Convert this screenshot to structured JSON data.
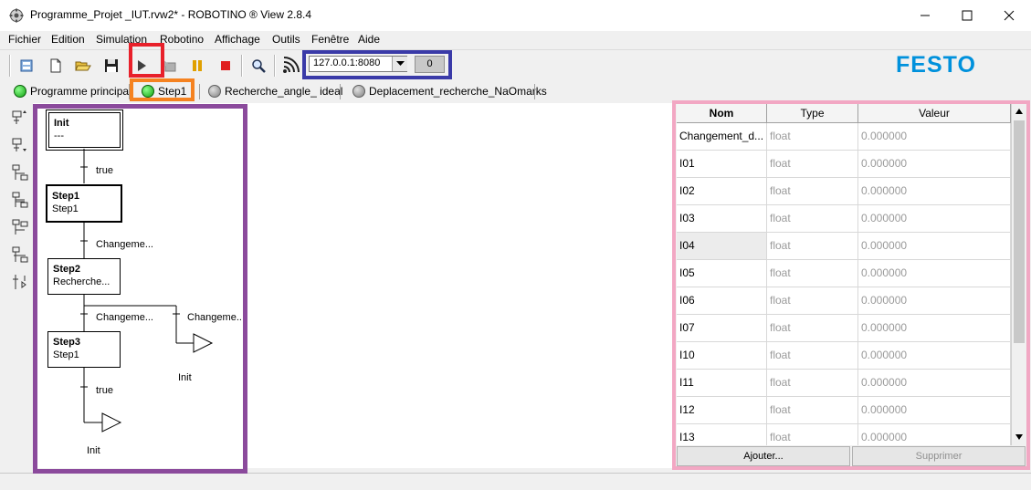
{
  "window": {
    "title": "Programme_Projet _IUT.rvw2* - ROBOTINO ® View 2.8.4"
  },
  "menu": [
    "Fichier",
    "Edition",
    "Simulation",
    "Robotino",
    "Affichage",
    "Outils",
    "Fenêtre",
    "Aide"
  ],
  "toolbar": {
    "address": "127.0.0.1:8080",
    "connection_count": "0",
    "brand": "FESTO"
  },
  "tabs": [
    {
      "label": "Programme principal",
      "status": "green"
    },
    {
      "label": "Step1",
      "status": "green"
    },
    {
      "label": "Recherche_angle_ ideal",
      "status": "gray"
    },
    {
      "label": "Deplacement_recherche_NaOmarks",
      "status": "gray"
    }
  ],
  "sequence": {
    "steps": [
      {
        "name": "Init",
        "sub": "---"
      },
      {
        "name": "Step1",
        "sub": "Step1"
      },
      {
        "name": "Step2",
        "sub": "Recherche..."
      },
      {
        "name": "Step3",
        "sub": "Step1"
      }
    ],
    "transitions": [
      "true",
      "Changeme...",
      "Changeme...",
      "Changeme..",
      "true"
    ],
    "jumps": [
      "Init",
      "Init"
    ]
  },
  "variables": {
    "headers": [
      "Nom",
      "Type",
      "Valeur"
    ],
    "rows": [
      {
        "name": "Changement_d...",
        "type": "float",
        "value": "0.000000"
      },
      {
        "name": "I01",
        "type": "float",
        "value": "0.000000"
      },
      {
        "name": "I02",
        "type": "float",
        "value": "0.000000"
      },
      {
        "name": "I03",
        "type": "float",
        "value": "0.000000"
      },
      {
        "name": "I04",
        "type": "float",
        "value": "0.000000"
      },
      {
        "name": "I05",
        "type": "float",
        "value": "0.000000"
      },
      {
        "name": "I06",
        "type": "float",
        "value": "0.000000"
      },
      {
        "name": "I07",
        "type": "float",
        "value": "0.000000"
      },
      {
        "name": "I10",
        "type": "float",
        "value": "0.000000"
      },
      {
        "name": "I11",
        "type": "float",
        "value": "0.000000"
      },
      {
        "name": "I12",
        "type": "float",
        "value": "0.000000"
      },
      {
        "name": "I13",
        "type": "float",
        "value": "0.000000"
      }
    ],
    "add_button": "Ajouter...",
    "delete_button": "Supprimer"
  },
  "colors": {
    "highlight_red": "#e8202a",
    "highlight_orange": "#f58220",
    "highlight_blue": "#3a3aa8",
    "highlight_purple": "#8b4a9c",
    "highlight_pink": "#f2a7c3",
    "status_green": "#22c022",
    "brand_blue": "#0091dc"
  }
}
